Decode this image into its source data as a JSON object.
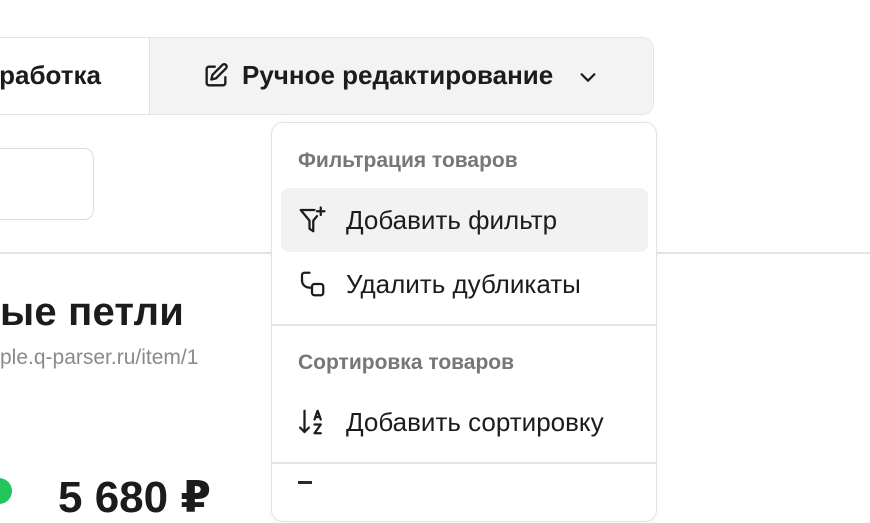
{
  "toolbar": {
    "processing_label": "работка",
    "manual_edit_label": "Ручное редактирование",
    "edit_icon": "edit-icon",
    "chevron_icon": "chevron-down-icon"
  },
  "product": {
    "title": "ые петли",
    "url": "ple.q-parser.ru/item/1",
    "price": "5 680 ₽",
    "status_color": "#22c55e"
  },
  "menu": {
    "filter_section": {
      "title": "Фильтрация товаров",
      "items": [
        {
          "label": "Добавить фильтр",
          "icon": "filter-plus-icon",
          "highlighted": true
        },
        {
          "label": "Удалить дубликаты",
          "icon": "remove-duplicates-icon",
          "highlighted": false
        }
      ]
    },
    "sort_section": {
      "title": "Сортировка товаров",
      "items": [
        {
          "label": "Добавить сортировку",
          "icon": "sort-az-icon",
          "highlighted": false
        }
      ]
    }
  },
  "colors": {
    "accent": "#22c55e",
    "hover_bg": "#f2f2f2",
    "border": "#e2e2e2",
    "muted_text": "#777777"
  }
}
